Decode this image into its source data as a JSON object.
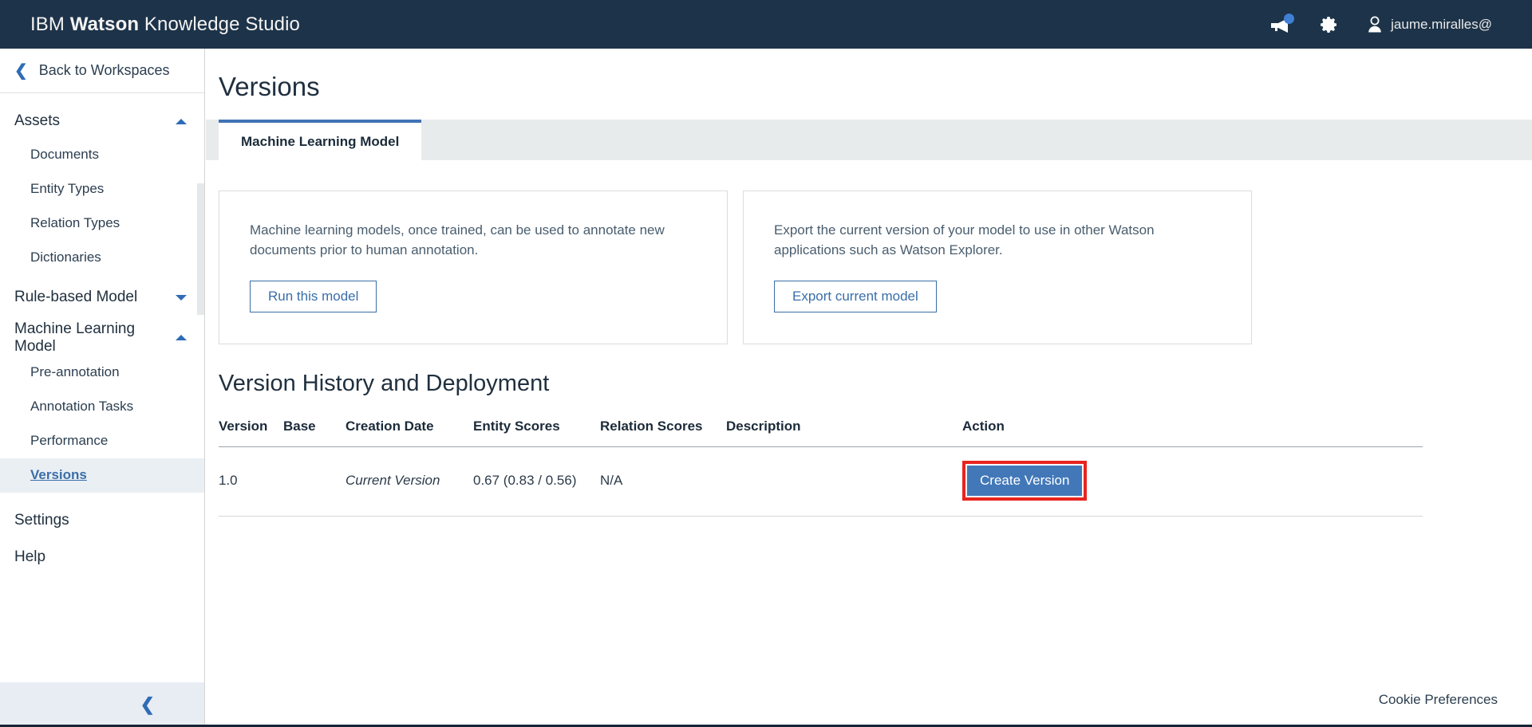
{
  "topbar": {
    "brand_prefix": "IBM ",
    "brand_bold": "Watson",
    "brand_suffix": " Knowledge Studio",
    "announcement_icon": "megaphone-icon",
    "announcement_has_badge": true,
    "settings_icon": "gear-icon",
    "user_icon": "user-avatar-icon",
    "user_label": "jaume.miralles@",
    "background": "#1d3349",
    "badge_color": "#3f7fd4"
  },
  "sidebar": {
    "back_label": "Back to Workspaces",
    "back_icon": "chevron-left-icon",
    "groups": [
      {
        "title": "Assets",
        "caret": "caret-up-icon",
        "expanded": true,
        "items": [
          {
            "label": "Documents",
            "active": false
          },
          {
            "label": "Entity Types",
            "active": false
          },
          {
            "label": "Relation Types",
            "active": false
          },
          {
            "label": "Dictionaries",
            "active": false
          }
        ]
      },
      {
        "title": "Rule-based Model",
        "caret": "caret-down-icon",
        "expanded": false,
        "items": []
      },
      {
        "title": "Machine Learning Model",
        "caret": "caret-up-icon",
        "expanded": true,
        "items": [
          {
            "label": "Pre-annotation",
            "active": false
          },
          {
            "label": "Annotation Tasks",
            "active": false
          },
          {
            "label": "Performance",
            "active": false
          },
          {
            "label": "Versions",
            "active": true
          }
        ]
      }
    ],
    "links": [
      {
        "label": "Settings"
      },
      {
        "label": "Help"
      }
    ],
    "collapse_icon": "chevron-left-icon",
    "active_item_background": "#eaeff4"
  },
  "main": {
    "page_title": "Versions",
    "tabs": [
      {
        "label": "Machine Learning Model",
        "active": true
      }
    ],
    "cards": [
      {
        "text": "Machine learning models, once trained, can be used to annotate new documents prior to human annotation.",
        "button_label": "Run this model"
      },
      {
        "text": "Export the current version of your model to use in other Watson applications such as Watson Explorer.",
        "button_label": "Export current model"
      }
    ],
    "section_title": "Version History and Deployment",
    "table": {
      "columns": [
        "Version",
        "Base",
        "Creation Date",
        "Entity Scores",
        "Relation Scores",
        "Description",
        "Action"
      ],
      "rows": [
        {
          "version": "1.0",
          "base": "",
          "creation_date": "Current Version",
          "entity_scores": "0.67 (0.83 / 0.56)",
          "relation_scores": "N/A",
          "description": "",
          "action_label": "Create Version",
          "action_highlighted": true
        }
      ]
    },
    "accent_color": "#4278b8",
    "highlight_color": "#e8241f"
  },
  "footer": {
    "cookie_label": "Cookie Preferences"
  }
}
